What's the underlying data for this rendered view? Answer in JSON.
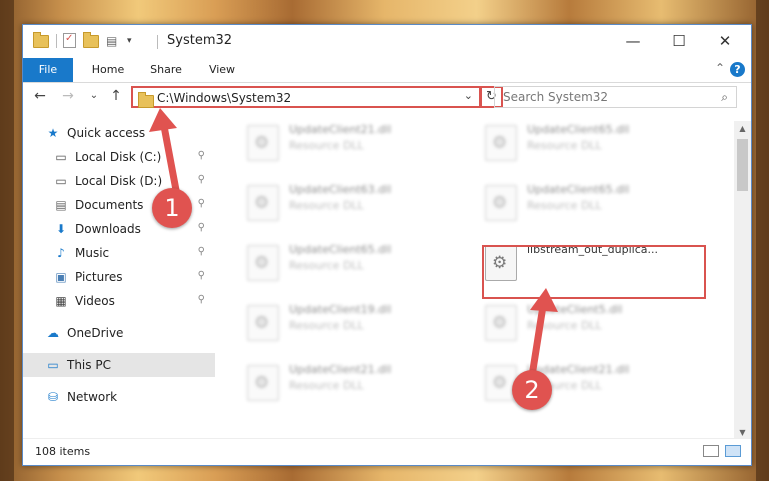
{
  "window": {
    "title": "System32",
    "minimize_glyph": "—",
    "maximize_glyph": "☐",
    "close_glyph": "✕"
  },
  "ribbon": {
    "tabs": [
      "File",
      "Home",
      "Share",
      "View"
    ],
    "help_glyph": "?",
    "collapse_glyph": "⌃"
  },
  "nav": {
    "back": "←",
    "forward": "→",
    "recent": "⌄",
    "up": "↑"
  },
  "address": {
    "path": "C:\\Windows\\System32",
    "dropdown_glyph": "⌄",
    "refresh_glyph": "↻"
  },
  "search": {
    "placeholder": "Search System32",
    "icon_glyph": "⌕"
  },
  "sidebar": {
    "items": [
      {
        "label": "Quick access",
        "icon": "star-icon",
        "glyph": "★",
        "color": "#1979ca",
        "pinned": false
      },
      {
        "label": "Local Disk (C:)",
        "icon": "drive-icon",
        "glyph": "▭",
        "color": "#555555",
        "pinned": true
      },
      {
        "label": "Local Disk (D:)",
        "icon": "drive-icon",
        "glyph": "▭",
        "color": "#555555",
        "pinned": true
      },
      {
        "label": "Documents",
        "icon": "documents-icon",
        "glyph": "▤",
        "color": "#666666",
        "pinned": true
      },
      {
        "label": "Downloads",
        "icon": "downloads-icon",
        "glyph": "⬇",
        "color": "#1979ca",
        "pinned": true
      },
      {
        "label": "Music",
        "icon": "music-icon",
        "glyph": "♪",
        "color": "#1979ca",
        "pinned": true
      },
      {
        "label": "Pictures",
        "icon": "pictures-icon",
        "glyph": "▣",
        "color": "#4a7fb5",
        "pinned": true
      },
      {
        "label": "Videos",
        "icon": "videos-icon",
        "glyph": "▦",
        "color": "#444444",
        "pinned": true
      },
      {
        "label": "OneDrive",
        "icon": "onedrive-icon",
        "glyph": "☁",
        "color": "#1979ca",
        "pinned": false
      },
      {
        "label": "This PC",
        "icon": "this-pc-icon",
        "glyph": "▭",
        "color": "#1979ca",
        "pinned": false,
        "selected": true
      },
      {
        "label": "Network",
        "icon": "network-icon",
        "glyph": "⛁",
        "color": "#1979ca",
        "pinned": false
      }
    ],
    "pin_glyph": "📌"
  },
  "files": [
    {
      "name": "UpdateClient21.dll",
      "type": "Resource DLL",
      "blurred": true
    },
    {
      "name": "UpdateClient65.dll",
      "type": "Resource DLL",
      "blurred": true
    },
    {
      "name": "UpdateClient63.dll",
      "type": "Resource DLL",
      "blurred": true
    },
    {
      "name": "UpdateClient65.dll",
      "type": "Resource DLL",
      "blurred": true
    },
    {
      "name": "UpdateClient65.dll",
      "type": "Resource DLL",
      "blurred": true
    },
    {
      "name": "libstream_out_duplica...",
      "type": "",
      "blurred": false
    },
    {
      "name": "UpdateClient19.dll",
      "type": "Resource DLL",
      "blurred": true
    },
    {
      "name": "UpdateClient5.dll",
      "type": "Resource DLL",
      "blurred": true
    },
    {
      "name": "UpdateClient21.dll",
      "type": "Resource DLL",
      "blurred": true
    },
    {
      "name": "UpdateClient21.dll",
      "type": "Resource DLL",
      "blurred": true
    }
  ],
  "status": {
    "count": "108 items"
  },
  "annotations": {
    "step1": "1",
    "step2": "2",
    "color": "#e05350"
  }
}
